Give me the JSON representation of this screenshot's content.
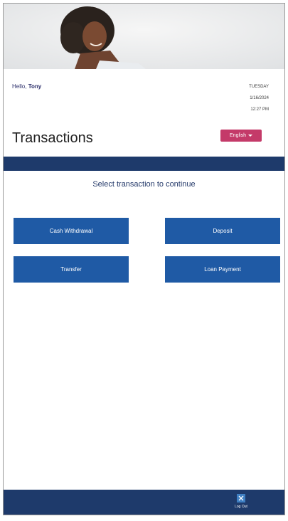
{
  "header": {
    "greeting_prefix": "Hello, ",
    "user_name": "Tony",
    "day": "TUESDAY",
    "date": "1/16/2024",
    "time": "12:27 PM"
  },
  "page": {
    "title": "Transactions",
    "language_label": "English",
    "subtitle": "Select transaction to continue"
  },
  "transactions": [
    {
      "label": "Cash Withdrawal"
    },
    {
      "label": "Deposit"
    },
    {
      "label": "Transfer"
    },
    {
      "label": "Loan Payment"
    }
  ],
  "footer": {
    "logout_label": "Log Out"
  },
  "colors": {
    "navy": "#1e3a6b",
    "button_blue": "#1f5aa5",
    "language_pink": "#c43a69"
  }
}
